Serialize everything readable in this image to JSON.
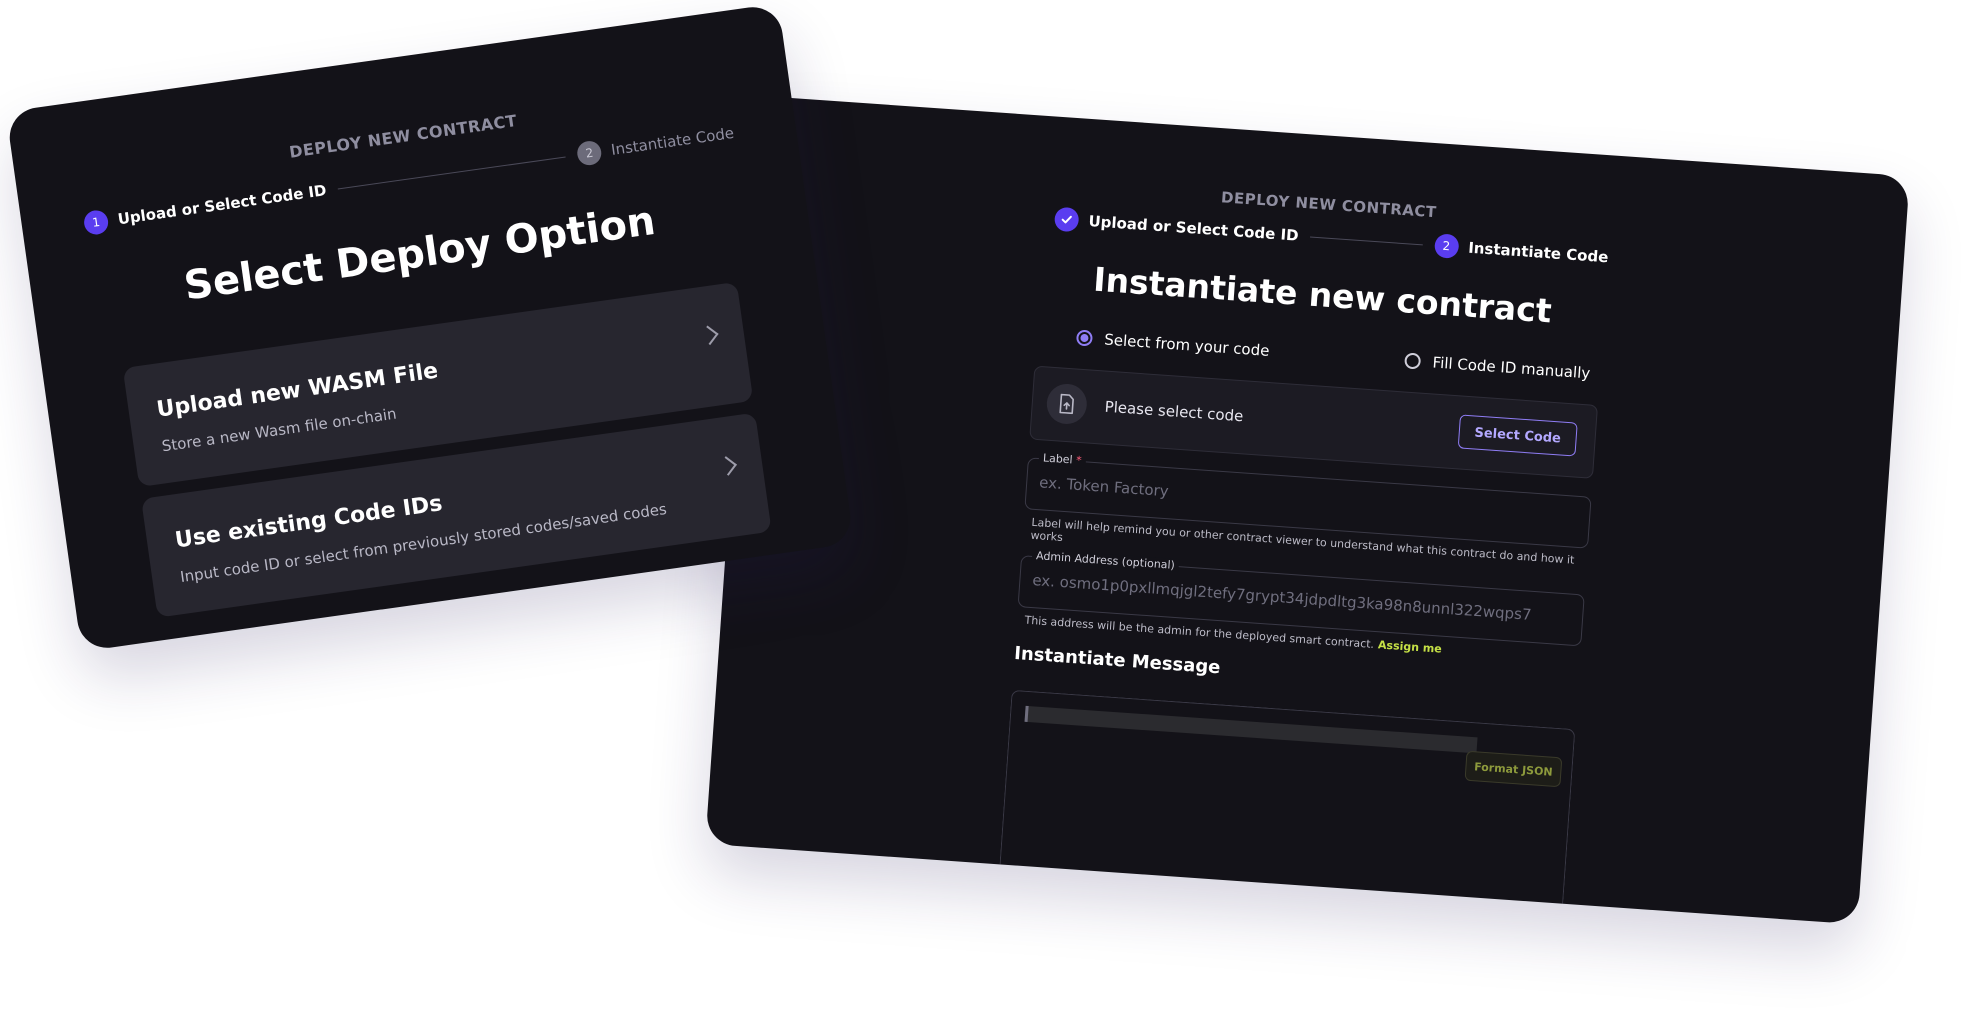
{
  "deploy_options_panel": {
    "header": "DEPLOY NEW CONTRACT",
    "steps": [
      {
        "number": "1",
        "label": "Upload or Select Code ID",
        "state": "active"
      },
      {
        "number": "2",
        "label": "Instantiate Code",
        "state": "inactive"
      }
    ],
    "title": "Select Deploy Option",
    "options": [
      {
        "title": "Upload new WASM File",
        "description": "Store a new Wasm file on-chain"
      },
      {
        "title": "Use existing Code IDs",
        "description": "Input code ID or select from previously stored codes/saved codes"
      }
    ]
  },
  "instantiate_panel": {
    "header": "DEPLOY NEW CONTRACT",
    "steps": [
      {
        "number": "",
        "label": "Upload or Select Code ID",
        "state": "done"
      },
      {
        "number": "2",
        "label": "Instantiate Code",
        "state": "active"
      }
    ],
    "title": "Instantiate new contract",
    "radio_options": [
      {
        "label": "Select from your code",
        "checked": true
      },
      {
        "label": "Fill Code ID manually",
        "checked": false
      }
    ],
    "code_select": {
      "placeholder": "Please select code",
      "button_label": "Select Code"
    },
    "label_field": {
      "caption": "Label",
      "required_mark": "*",
      "placeholder": "ex. Token Factory",
      "helper": "Label will help remind you or other contract viewer to understand what this contract do and how it works"
    },
    "admin_field": {
      "caption": "Admin Address (optional)",
      "placeholder": "ex. osmo1p0pxllmqjgl2tefy7grypt34jdpdltg3ka98n8unnl322wqps7",
      "helper": "This address will be the admin for the deployed smart contract.",
      "assign_link": "Assign me"
    },
    "message_section": {
      "title": "Instantiate Message",
      "format_button": "Format JSON"
    }
  },
  "colors": {
    "background": "#ffffff",
    "panel": "#131218",
    "card": "#27262f",
    "accent": "#5a3df0",
    "accent_light": "#8f7df5",
    "link": "#c5e046"
  }
}
